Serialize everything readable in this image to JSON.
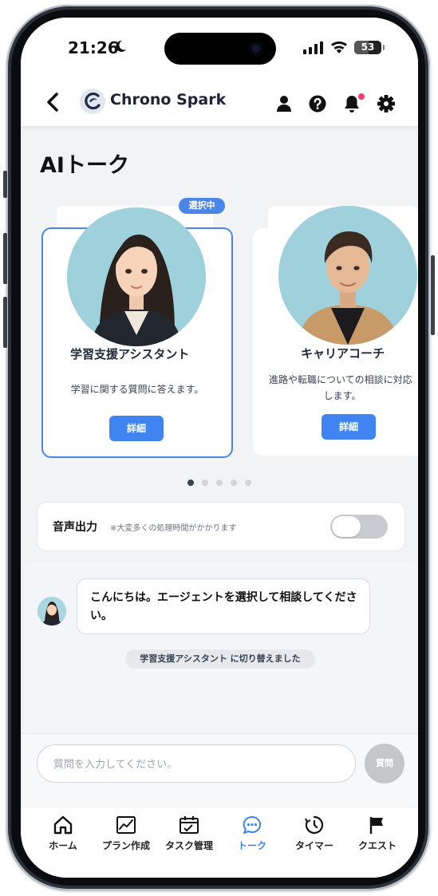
{
  "status": {
    "time": "21:26",
    "battery": "53",
    "battery_level": 0.53
  },
  "header": {
    "brand": "Chrono Spark"
  },
  "page": {
    "title": "AIトーク"
  },
  "agents": [
    {
      "name": "学習支援アシスタント",
      "description": "学習に関する質問に答えます。",
      "detail_label": "詳細",
      "badge": "選択中"
    },
    {
      "name": "キャリアコーチ",
      "description_line1": "進路や転職についての相談に対応",
      "description_line2": "します。",
      "detail_label": "詳細"
    }
  ],
  "carousel": {
    "pages": 5,
    "active": 1
  },
  "voice": {
    "label": "音声出力",
    "note": "※大変多くの処理時間がかかります",
    "enabled": false
  },
  "chat": {
    "message": "こんにちは。エージェントを選択して相談してください。",
    "system": "学習支援アシスタント に切り替えました"
  },
  "composer": {
    "placeholder": "質問を入力してください。",
    "send_label": "質問"
  },
  "tabs": [
    {
      "label": "ホーム",
      "icon": "home-icon"
    },
    {
      "label": "プラン作成",
      "icon": "chart-icon"
    },
    {
      "label": "タスク管理",
      "icon": "calendar-icon"
    },
    {
      "label": "トーク",
      "icon": "chat-icon",
      "active": true
    },
    {
      "label": "タイマー",
      "icon": "timer-icon"
    },
    {
      "label": "クエスト",
      "icon": "flag-icon"
    }
  ],
  "colors": {
    "accent": "#3f84f0",
    "notification": "#ff3b6b",
    "toggle_off": "#c9cbd0"
  }
}
